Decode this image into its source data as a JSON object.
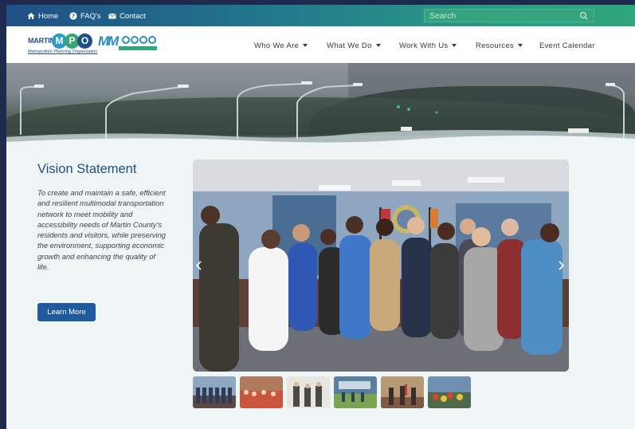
{
  "topbar": {
    "home_label": "Home",
    "faqs_label": "FAQ's",
    "contact_label": "Contact",
    "search_placeholder": "Search"
  },
  "header": {
    "logo_mpo_word": "MARTIN",
    "logo_mpo_letters": [
      "M",
      "P",
      "O"
    ],
    "logo_mpo_sub": "Metropolitan Planning Organization",
    "logo_mm_word": "MM",
    "nav": [
      {
        "label": "Who We Are",
        "has_dropdown": true
      },
      {
        "label": "What We Do",
        "has_dropdown": true
      },
      {
        "label": "Work With Us",
        "has_dropdown": true
      },
      {
        "label": "Resources",
        "has_dropdown": true
      },
      {
        "label": "Event Calendar",
        "has_dropdown": false
      }
    ]
  },
  "vision": {
    "title": "Vision Statement",
    "text": "To create and maintain a safe, efficient and resilient multimodal transportation network to meet mobility and accessibility needs of Martin County's residents and visitors, while preserving the environment, supporting economic growth and enhancing the quality of life.",
    "button_label": "Learn More"
  },
  "gallery": {
    "thumbnail_count": 6
  },
  "colors": {
    "brand_blue": "#1f5a9c",
    "brand_green": "#2fa67c",
    "title_blue": "#1f4f86",
    "page_bg": "#eef5f4"
  },
  "icons": {
    "home": "home-icon",
    "faq": "question-circle-icon",
    "contact": "envelope-icon",
    "search": "search-icon"
  }
}
